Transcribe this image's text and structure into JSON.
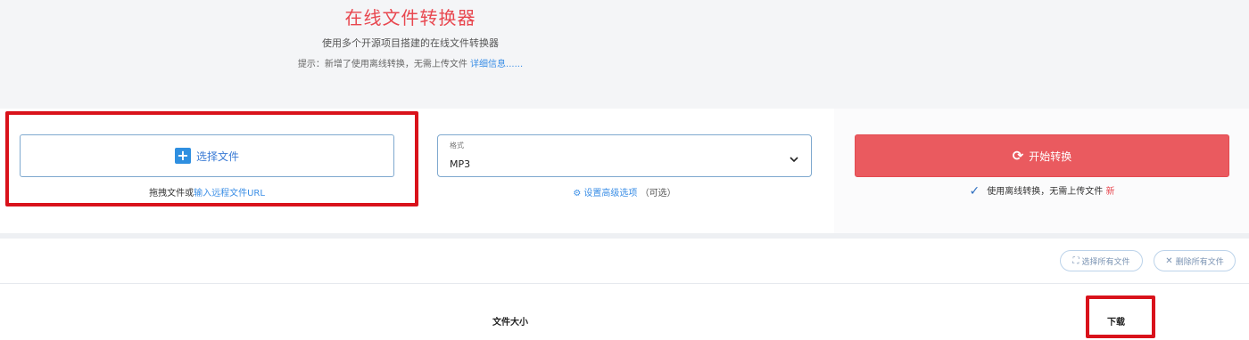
{
  "header": {
    "title": "在线文件转换器",
    "subtitle": "使用多个开源项目搭建的在线文件转换器",
    "notice_text": "提示：新增了使用离线转换，无需上传文件 ",
    "notice_link": "详细信息......"
  },
  "upload": {
    "choose_label": "选择文件",
    "hint_prefix": "拖拽文件或",
    "hint_link": "输入远程文件URL"
  },
  "format": {
    "caption": "格式",
    "value": "MP3"
  },
  "advanced": {
    "link": "设置高级选项",
    "suffix": "（可选）"
  },
  "convert": {
    "label": "开始转换",
    "online_text": "使用离线转换，无需上传文件 ",
    "new_tag": "新"
  },
  "toolbar": {
    "select_all": "选择所有文件",
    "delete_selected": "删除所有文件"
  },
  "table": {
    "headers": {
      "size": "文件大小",
      "download": "下载"
    }
  },
  "colors": {
    "accent_red": "#e8474f",
    "button_red": "#ea5a5f",
    "link_blue": "#3a8ee6",
    "highlight": "#d9121b"
  }
}
